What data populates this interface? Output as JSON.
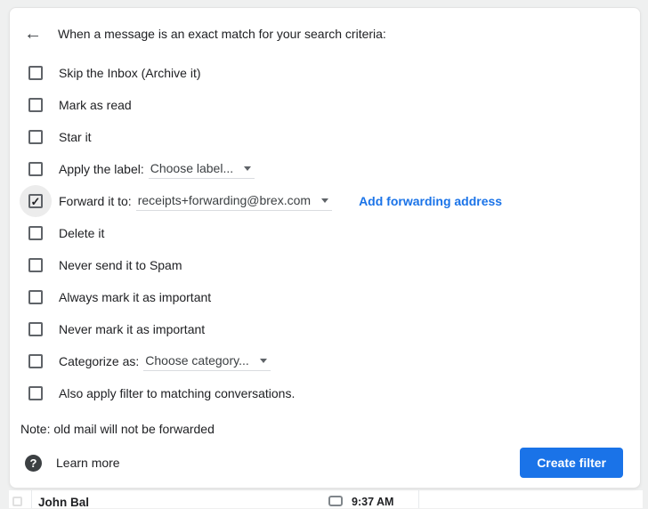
{
  "colors": {
    "accent_blue": "#1a73e8",
    "page_bg": "#eff0f0",
    "dialog_bg": "#ffffff",
    "text_primary": "#202124",
    "text_secondary": "#3c4043",
    "checkbox_border": "#5f6368",
    "dropdown_underline": "#dadce0",
    "checked_halo": "#ececec"
  },
  "icons": {
    "back_arrow": "←",
    "checkmark": "✓",
    "help": "?"
  },
  "dialog": {
    "title": "When a message is an exact match for your search criteria:",
    "rows": [
      {
        "label": "Skip the Inbox (Archive it)",
        "checked": false
      },
      {
        "label": "Mark as read",
        "checked": false
      },
      {
        "label": "Star it",
        "checked": false
      },
      {
        "label": "Apply the label:",
        "checked": false,
        "dropdown_value": "Choose label..."
      },
      {
        "label": "Forward it to:",
        "checked": true,
        "dropdown_value": "receipts+forwarding@brex.com",
        "link_label": "Add forwarding address"
      },
      {
        "label": "Delete it",
        "checked": false
      },
      {
        "label": "Never send it to Spam",
        "checked": false
      },
      {
        "label": "Always mark it as important",
        "checked": false
      },
      {
        "label": "Never mark it as important",
        "checked": false
      },
      {
        "label": "Categorize as:",
        "checked": false,
        "dropdown_value": "Choose category..."
      },
      {
        "label": "Also apply filter to matching conversations.",
        "checked": false
      }
    ],
    "note": "Note: old mail will not be forwarded",
    "footer": {
      "learn_more_label": "Learn more",
      "create_filter_label": "Create filter"
    }
  },
  "background_inbox_row": {
    "sender": "John Bal",
    "time": "9:37 AM"
  }
}
